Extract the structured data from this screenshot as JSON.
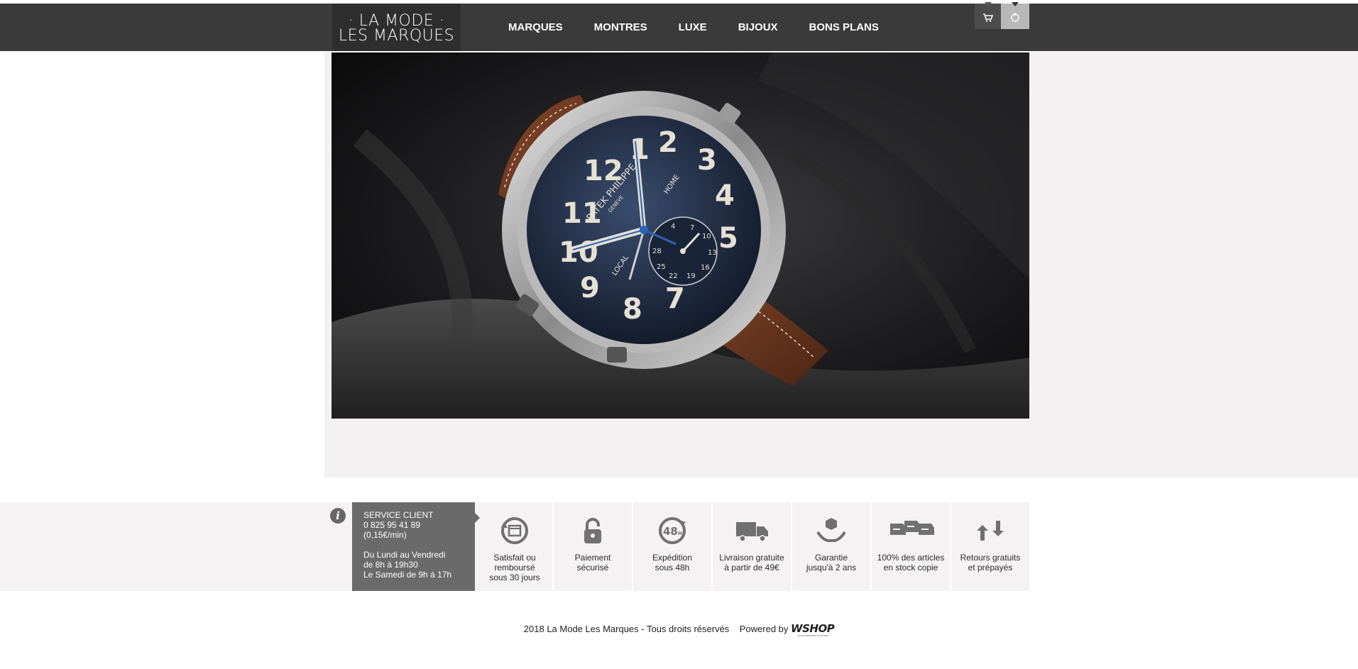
{
  "header": {
    "logo_line1": "· LA MODE ·",
    "logo_line2": "LES MARQUES",
    "nav": [
      "MARQUES",
      "MONTRES",
      "LUXE",
      "BIJOUX",
      "BONS PLANS"
    ]
  },
  "hero": {
    "brand": "PATEK PHILIPPE",
    "city": "GENEVE",
    "local": "LOCAL",
    "home": "HOME"
  },
  "service": {
    "title": "SERVICE CLIENT",
    "phone": "0 825 95 41 89",
    "rate": "(0,15€/min)",
    "hours1": "Du Lundi au Vendredi",
    "hours2": "de 8h à 19h30",
    "hours3": "Le Samedi de 9h à 17h"
  },
  "features": [
    {
      "icon": "refund-icon",
      "label": "Satisfait ou\nremboursé\nsous 30 jours"
    },
    {
      "icon": "padlock-icon",
      "label": "Paiement\nsécurisé"
    },
    {
      "icon": "48h-icon",
      "label": "Expédition\nsous 48h"
    },
    {
      "icon": "truck-icon",
      "label": "Livraison gratuite\nà partir de 49€"
    },
    {
      "icon": "warranty-box-icon",
      "label": "Garantie\njusqu'à 2 ans"
    },
    {
      "icon": "stock-boxes-icon",
      "label": "100% des articles\nen stock copie"
    },
    {
      "icon": "exchange-arrows-icon",
      "label": "Retours gratuits\net prépayés"
    }
  ],
  "footer": {
    "copyright": "2018 La Mode Les Marques - Tous droits réservés",
    "powered": "Powered by",
    "wshop": "WSHOP",
    "wshop_tagline": "OUR ECOMMERCE PLATFORM"
  },
  "colors": {
    "header_bg": "#3a3a3a",
    "logo_bg": "#2e2e2e",
    "main_bg": "#f3f1f1",
    "service_bg": "#6a6a6a",
    "icon_gray": "#707070",
    "strap_brown": "#6e3a22",
    "dial_navy": "#1f2c44"
  }
}
